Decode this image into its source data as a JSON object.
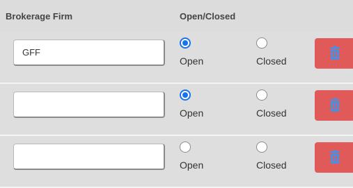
{
  "header": {
    "col_firm": "Brokerage Firm",
    "col_open_closed": "Open/Closed"
  },
  "rows": [
    {
      "firm_value": "GFF",
      "status": "Open",
      "open_label": "Open",
      "closed_label": "Closed"
    },
    {
      "firm_value": "",
      "status": "Open",
      "open_label": "Open",
      "closed_label": "Closed"
    },
    {
      "firm_value": "",
      "status": "",
      "open_label": "Open",
      "closed_label": "Closed"
    }
  ],
  "colors": {
    "delete_button": "#e05a5a",
    "radio_checked": "#1a73e8",
    "trash_icon": "#4a90e2"
  },
  "icons": {
    "delete": "trash-icon"
  }
}
